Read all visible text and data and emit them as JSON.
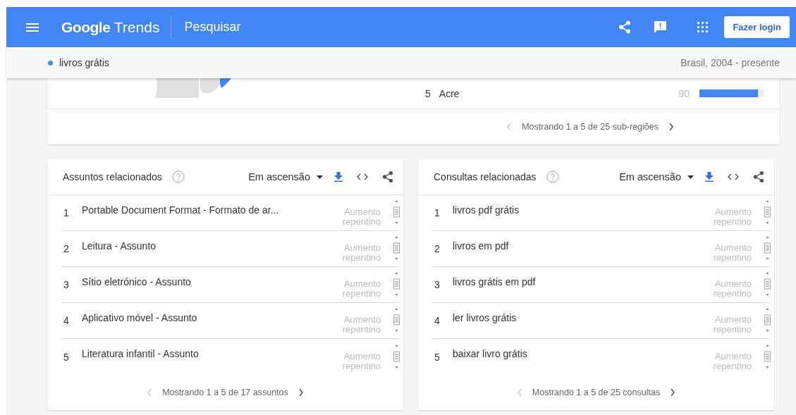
{
  "header": {
    "logo_google": "Google",
    "logo_product": "Trends",
    "title": "Pesquisar",
    "login": "Fazer login"
  },
  "search_bar": {
    "term": "livros grátis",
    "scope": "Brasil, 2004 - presente"
  },
  "region_card": {
    "rows": [
      {
        "rank": "5",
        "name": "Acre",
        "value": "90",
        "level": 0.9
      }
    ],
    "pagination": {
      "text": "Mostrando 1 a 5 de 25 sub-regiões",
      "prev_disabled": true
    }
  },
  "panels": [
    {
      "title": "Assuntos relacionados",
      "filter": "Em ascensão",
      "items": [
        {
          "rank": "1",
          "label": "Portable Document Format - Formato de ar...",
          "trend": "Aumento repentino"
        },
        {
          "rank": "2",
          "label": "Leitura - Assunto",
          "trend": "Aumento repentino"
        },
        {
          "rank": "3",
          "label": "Sítio eletrónico - Assunto",
          "trend": "Aumento repentino"
        },
        {
          "rank": "4",
          "label": "Aplicativo móvel - Assunto",
          "trend": "Aumento repentino"
        },
        {
          "rank": "5",
          "label": "Literatura infantil - Assunto",
          "trend": "Aumento repentino"
        }
      ],
      "pagination": {
        "text": "Mostrando 1 a 5 de 17 assuntos",
        "prev_disabled": true
      }
    },
    {
      "title": "Consultas relacionadas",
      "filter": "Em ascensão",
      "items": [
        {
          "rank": "1",
          "label": "livros pdf grátis",
          "trend": "Aumento repentino"
        },
        {
          "rank": "2",
          "label": "livros em pdf",
          "trend": "Aumento repentino"
        },
        {
          "rank": "3",
          "label": "livros grátis em pdf",
          "trend": "Aumento repentino"
        },
        {
          "rank": "4",
          "label": "ler livros grátis",
          "trend": "Aumento repentino"
        },
        {
          "rank": "5",
          "label": "baixar livro grátis",
          "trend": "Aumento repentino"
        }
      ],
      "pagination": {
        "text": "Mostrando 1 a 5 de 25 consultas",
        "prev_disabled": true
      }
    }
  ]
}
